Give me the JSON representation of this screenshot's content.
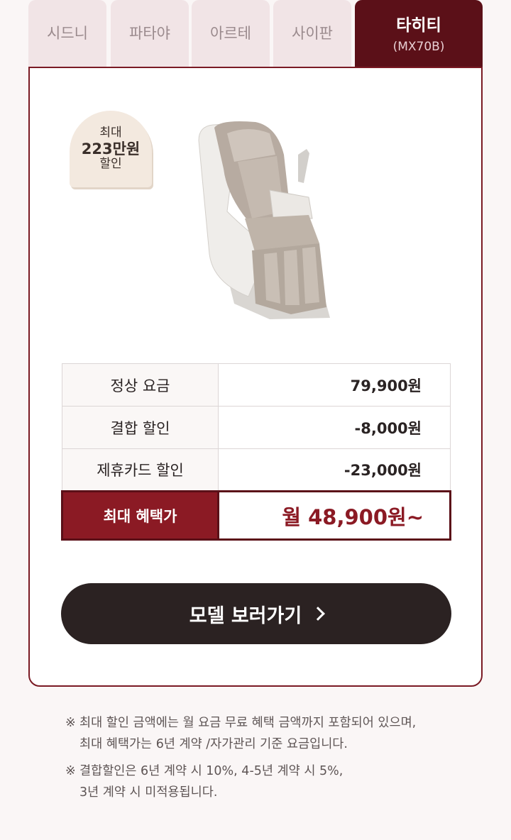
{
  "tabs": [
    {
      "label": "시드니",
      "sub": ""
    },
    {
      "label": "파타야",
      "sub": ""
    },
    {
      "label": "아르테",
      "sub": ""
    },
    {
      "label": "사이판",
      "sub": ""
    },
    {
      "label": "타히티",
      "sub": "(MX70B)"
    }
  ],
  "badge": {
    "line1": "최대",
    "line2": "223만원",
    "line3": "할인"
  },
  "price": {
    "rows": [
      {
        "label": "정상 요금",
        "value": "79,900원"
      },
      {
        "label": "결합 할인",
        "value": "-8,000원"
      },
      {
        "label": "제휴카드 할인",
        "value": "-23,000원"
      }
    ],
    "best_label": "최대 혜택가",
    "best_value": "월 48,900원~"
  },
  "cta_label": "모델 보러가기",
  "notes": [
    {
      "mark": "※",
      "line1": "최대 할인 금액에는 월 요금 무료 혜택 금액까지 포함되어 있으며,",
      "line2": "최대 혜택가는 6년 계약 /자가관리 기준 요금입니다."
    },
    {
      "mark": "※",
      "line1": "결합할인은 6년 계약 시 10%, 4-5년 계약 시 5%,",
      "line2": "3년 계약 시 미적용됩니다."
    }
  ],
  "colors": {
    "accent": "#8b1a24",
    "dark_tab": "#5b1018",
    "tab_bg": "#f1e4e6",
    "cta_bg": "#2b2222"
  },
  "icons": {
    "cta": "chevron-right-icon",
    "product": "massage-chair-image"
  }
}
